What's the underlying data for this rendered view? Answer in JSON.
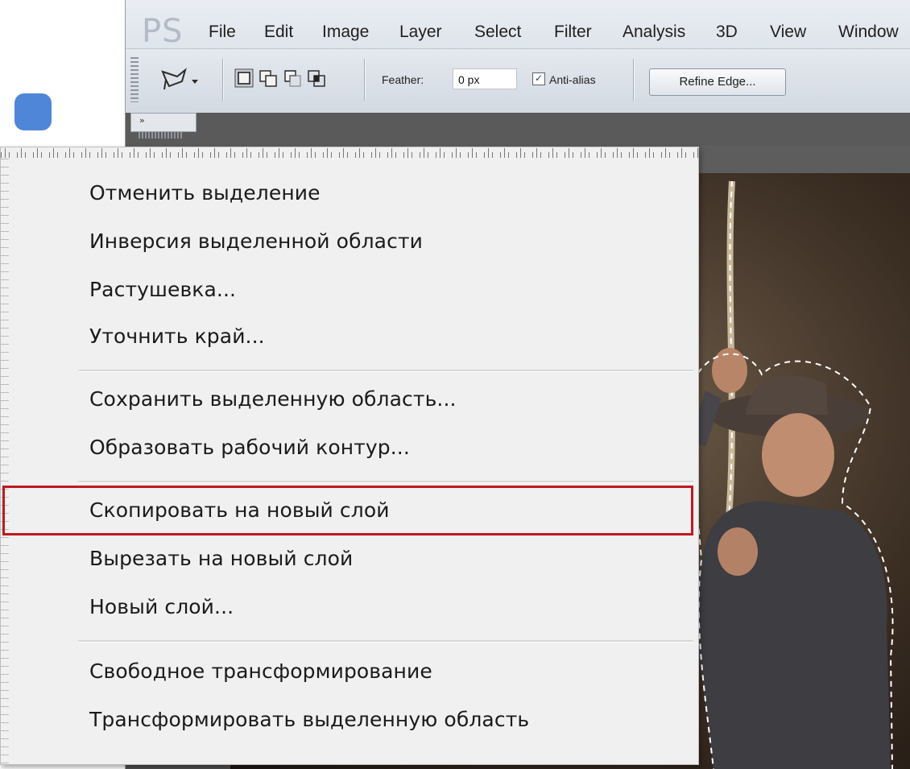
{
  "app": {
    "logo": "PS",
    "menu": [
      "File",
      "Edit",
      "Image",
      "Layer",
      "Select",
      "Filter",
      "Analysis",
      "3D",
      "View",
      "Window"
    ]
  },
  "options": {
    "feather_label": "Feather:",
    "feather_value": "0 px",
    "antialias_label": "Anti-alias",
    "antialias_checked": true,
    "refine_label": "Refine Edge..."
  },
  "panel": {
    "collapse_label": "»"
  },
  "context_menu": {
    "items": [
      "Отменить выделение",
      "Инверсия выделенной области",
      "Растушевка...",
      "Уточнить край...",
      "Сохранить выделенную область...",
      "Образовать рабочий контур...",
      "Скопировать на новый слой",
      "Вырезать на новый слой",
      "Новый слой...",
      "Свободное трансформирование",
      "Трансформировать выделенную область"
    ],
    "highlighted": "Скопировать на новый слой"
  },
  "colors": {
    "accent_dot": "#4f86d8",
    "highlight_border": "#c0191f"
  }
}
